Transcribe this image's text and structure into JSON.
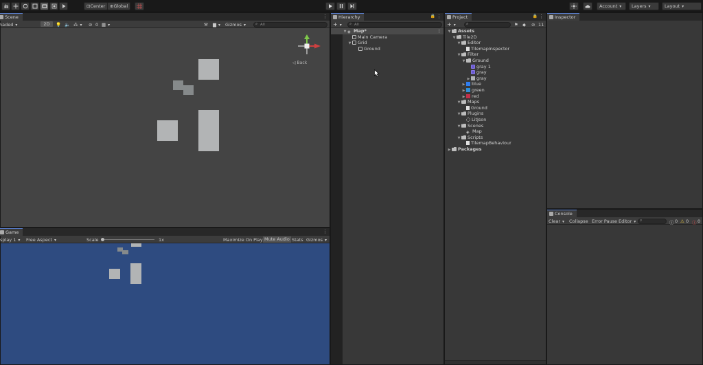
{
  "toolbar": {
    "pivot_label": "Center",
    "space_label": "Global",
    "account_label": "Account",
    "layers_label": "Layers",
    "layout_label": "Layout"
  },
  "scene": {
    "tab_label": "Scene",
    "shading_mode": "haded",
    "mode_2d": "2D",
    "hidden_count": "0",
    "gizmos_label": "Gizmos",
    "search_placeholder": "All",
    "back_label": "◁ Back"
  },
  "game": {
    "tab_label": "Game",
    "display_label": "splay 1",
    "aspect_label": "Free Aspect",
    "scale_label": "Scale",
    "scale_value": "1x",
    "maximize_label": "Maximize On Play",
    "mute_label": "Mute Audio",
    "stats_label": "Stats",
    "gizmos_label": "Gizmos"
  },
  "hierarchy": {
    "tab_label": "Hierarchy",
    "search_placeholder": "All",
    "items": [
      {
        "label": "Map*"
      },
      {
        "label": "Main Camera"
      },
      {
        "label": "Grid"
      },
      {
        "label": "Ground"
      }
    ]
  },
  "project": {
    "tab_label": "Project",
    "hidden_count": "11",
    "items": [
      {
        "label": "Assets"
      },
      {
        "label": "Tile2D"
      },
      {
        "label": "Editor"
      },
      {
        "label": "TilemapInspector"
      },
      {
        "label": "Filter"
      },
      {
        "label": "Ground"
      },
      {
        "label": "gray 1"
      },
      {
        "label": "gray"
      },
      {
        "label": "gray"
      },
      {
        "label": "blue"
      },
      {
        "label": "green"
      },
      {
        "label": "red"
      },
      {
        "label": "Maps"
      },
      {
        "label": "Ground"
      },
      {
        "label": "Plugins"
      },
      {
        "label": "LitJson"
      },
      {
        "label": "Scenes"
      },
      {
        "label": "Map"
      },
      {
        "label": "Scripts"
      },
      {
        "label": "TilemapBehaviour"
      },
      {
        "label": "Packages"
      }
    ]
  },
  "inspector": {
    "tab_label": "Inspector"
  },
  "console": {
    "tab_label": "Console",
    "clear_label": "Clear",
    "collapse_label": "Collapse",
    "error_pause_label": "Error Pause",
    "editor_label": "Editor",
    "log_count": "0",
    "warn_count": "0",
    "error_count": "0"
  },
  "colors": {
    "scene_bg": "#444444",
    "game_bg": "#2e4b80",
    "tile_light": "#b2b4b5",
    "tile_dark": "#868a8b",
    "blue_swatch": "#2f7df0",
    "green_swatch": "#2f8fd8",
    "red_swatch": "#c0304a",
    "selection": "#2c5d87"
  }
}
